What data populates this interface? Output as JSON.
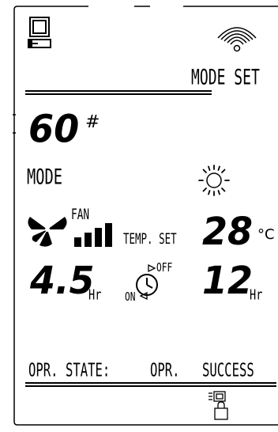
{
  "display": {
    "mode_set_label": "MODE SET",
    "channel_number": "60",
    "channel_suffix": "#",
    "mode_label": "MODE",
    "fan_label": "FAN",
    "temp_set_label": "TEMP. SET",
    "temp_value": "28",
    "temp_unit": "°C",
    "timer_off_hours": "4.5",
    "timer_off_unit": "Hr",
    "timer_off_label": "OFF",
    "timer_on_label": "ON",
    "timer_on_hours": "12",
    "timer_on_unit": "Hr",
    "opr_state_label": "OPR. STATE:",
    "opr_label": "OPR.",
    "opr_result": "SUCCESS",
    "fan_speed_level": 4,
    "fan_speed_max": 4
  },
  "icons": {
    "computer": "computer-icon",
    "wireless": "wireless-signal-icon",
    "sun": "sun-icon",
    "fan": "fan-icon",
    "clock": "clock-icon",
    "lock": "lock-icon"
  }
}
